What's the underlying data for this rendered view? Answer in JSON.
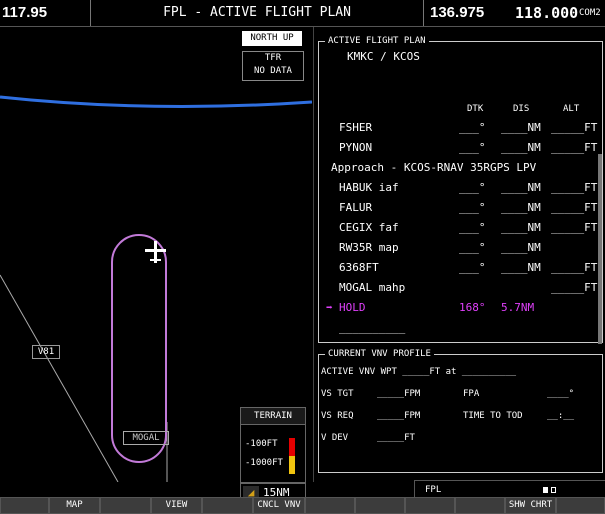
{
  "topbar": {
    "com1": "117.95",
    "title": "FPL - ACTIVE FLIGHT PLAN",
    "com_active": "136.975",
    "com_standby": "118.000",
    "com_label": "COM2"
  },
  "map": {
    "orientation": "NORTH UP",
    "tfr_label": "TFR",
    "tfr_status": "NO DATA",
    "airway": "V81",
    "fix_label": "MOGAL",
    "terrain": {
      "title": "TERRAIN",
      "line1": "-100FT",
      "line2": "-1000FT"
    },
    "range": "15NM"
  },
  "fpl": {
    "group_label": "ACTIVE FLIGHT PLAN",
    "route": "KMKC / KCOS",
    "columns": {
      "dtk": "DTK",
      "dis": "DIS",
      "alt": "ALT"
    },
    "rows": [
      {
        "wp": "FSHER",
        "dtk": "___°",
        "dis": "____NM",
        "alt": "_____FT"
      },
      {
        "wp": "PYNON",
        "dtk": "___°",
        "dis": "____NM",
        "alt": "_____FT"
      },
      {
        "wp": "Approach - KCOS-RNAV 35RGPS LPV",
        "dtk": "",
        "dis": "",
        "alt": ""
      },
      {
        "wp": "HABUK iaf",
        "dtk": "___°",
        "dis": "____NM",
        "alt": "_____FT"
      },
      {
        "wp": "FALUR",
        "dtk": "___°",
        "dis": "____NM",
        "alt": "_____FT"
      },
      {
        "wp": "CEGIX faf",
        "dtk": "___°",
        "dis": "____NM",
        "alt": "_____FT"
      },
      {
        "wp": "RW35R map",
        "dtk": "___°",
        "dis": "____NM",
        "alt": ""
      },
      {
        "wp": "6368FT",
        "dtk": "___°",
        "dis": "____NM",
        "alt": "_____FT"
      },
      {
        "wp": "MOGAL mahp",
        "dtk": "",
        "dis": "",
        "alt": "_____FT"
      },
      {
        "wp": "HOLD",
        "dtk": "168°",
        "dis": "5.7NM",
        "alt": "",
        "arrow": "➡"
      },
      {
        "wp": "__________",
        "dtk": "",
        "dis": "",
        "alt": ""
      }
    ]
  },
  "vnv": {
    "group_label": "CURRENT VNV PROFILE",
    "active_wpt": "ACTIVE VNV WPT _____FT at __________",
    "vs_tgt_label": "VS TGT",
    "vs_tgt_value": "_____FPM",
    "fpa_label": "FPA",
    "fpa_value": "____°",
    "vs_req_label": "VS REQ",
    "vs_req_value": "_____FPM",
    "tod_label": "TIME TO TOD",
    "tod_value": "__:__",
    "vdev_label": "V DEV",
    "vdev_value": "_____FT"
  },
  "footer": {
    "label": "FPL"
  },
  "softkeys": [
    "",
    "MAP",
    "",
    "VIEW",
    "",
    "CNCL VNV",
    "",
    "",
    "",
    "",
    "SHW CHRT",
    ""
  ],
  "colors": {
    "magenta": "#e040fb",
    "route_blue": "#2f6fe0",
    "terrain_red": "#e60000",
    "terrain_yellow": "#f1c40f"
  }
}
